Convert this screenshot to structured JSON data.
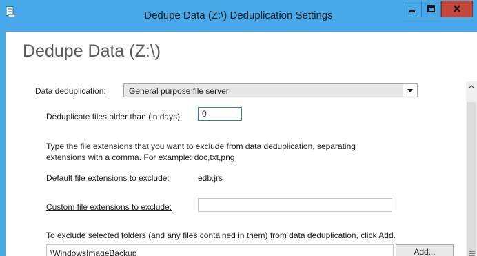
{
  "window": {
    "title": "Dedupe Data (Z:\\) Deduplication Settings",
    "accent_color": "#47a9e8",
    "close_color": "#c7463c",
    "icons": {
      "app": "server-drive-icon",
      "minimize": "minimize-icon",
      "maximize": "maximize-icon",
      "close": "close-icon"
    }
  },
  "page": {
    "heading": "Dedupe Data (Z:\\)"
  },
  "dedup": {
    "label": "Data deduplication:",
    "selected": "General purpose file server"
  },
  "age": {
    "label": "Deduplicate files older than (in days):",
    "value": "0"
  },
  "extensions": {
    "instructions_line1": "Type the file extensions that you want to exclude from data deduplication, separating",
    "instructions_line2": "extensions with a comma. For example: doc,txt,png",
    "default_label": "Default file extensions to exclude:",
    "default_value": "edb,jrs",
    "custom_label": "Custom file extensions to exclude:",
    "custom_value": ""
  },
  "folders": {
    "instructions": "To exclude selected folders (and any files contained in them) from data deduplication, click Add.",
    "items": [
      "\\WindowsImageBackup"
    ],
    "add_label": "Add..."
  }
}
